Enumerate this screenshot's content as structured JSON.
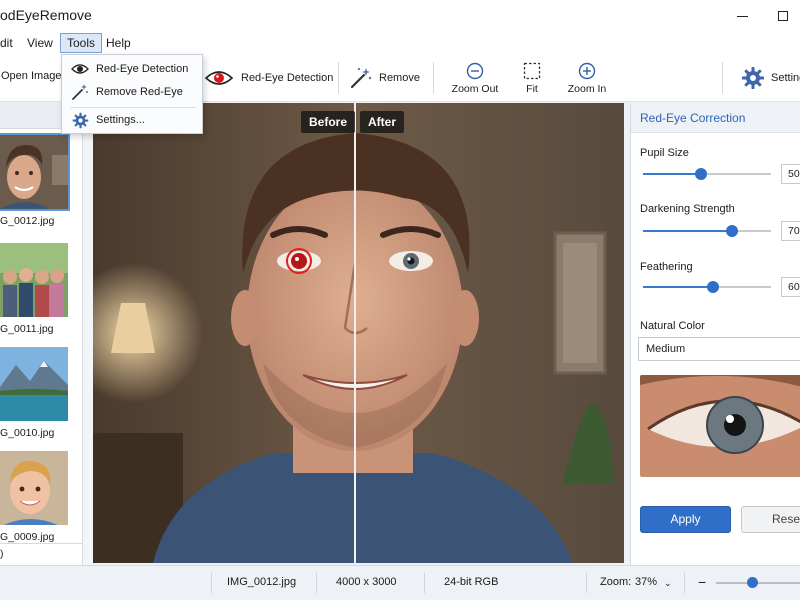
{
  "window": {
    "title": "odEyeRemove"
  },
  "menu": {
    "items": [
      {
        "label": "dit"
      },
      {
        "label": "View"
      },
      {
        "label": "Tools"
      },
      {
        "label": "Help"
      }
    ]
  },
  "tools_menu": {
    "items": [
      {
        "label": "Red-Eye Detection",
        "icon": "eye-icon"
      },
      {
        "label": "Remove Red-Eye",
        "icon": "magic-wand-icon"
      },
      {
        "label": "Settings...",
        "icon": "gear-icon"
      }
    ]
  },
  "toolbar": {
    "open_label": "Open Image",
    "detect_label": "Red-Eye Detection",
    "remove_label": "Remove",
    "zoom_out_label": "Zoom Out",
    "fit_label": "Fit",
    "zoom_in_label": "Zoom In",
    "settings_label": "Setting"
  },
  "thumbnails": [
    {
      "name": "G_0012.jpg",
      "selected": true
    },
    {
      "name": "G_0011.jpg",
      "selected": false
    },
    {
      "name": "G_0010.jpg",
      "selected": false
    },
    {
      "name": "G_0009.jpg",
      "selected": false
    }
  ],
  "sidebar_footer": ")",
  "canvas": {
    "before_label": "Before",
    "after_label": "After"
  },
  "panel": {
    "title": "Red-Eye Correction",
    "pupil_size": {
      "label": "Pupil Size",
      "value": "50"
    },
    "darkening": {
      "label": "Darkening Strength",
      "value": "70"
    },
    "feathering": {
      "label": "Feathering",
      "value": "60"
    },
    "natural_color": {
      "label": "Natural Color",
      "value": "Medium"
    },
    "apply_label": "Apply",
    "reset_label": "Reset"
  },
  "status": {
    "filename": "IMG_0012.jpg",
    "dimensions": "4000 x 3000",
    "color_depth": "24-bit RGB",
    "zoom_label": "Zoom:",
    "zoom_value": "37%"
  },
  "colors": {
    "accent": "#2f6fc8",
    "red_eye_marker": "#e02020"
  }
}
